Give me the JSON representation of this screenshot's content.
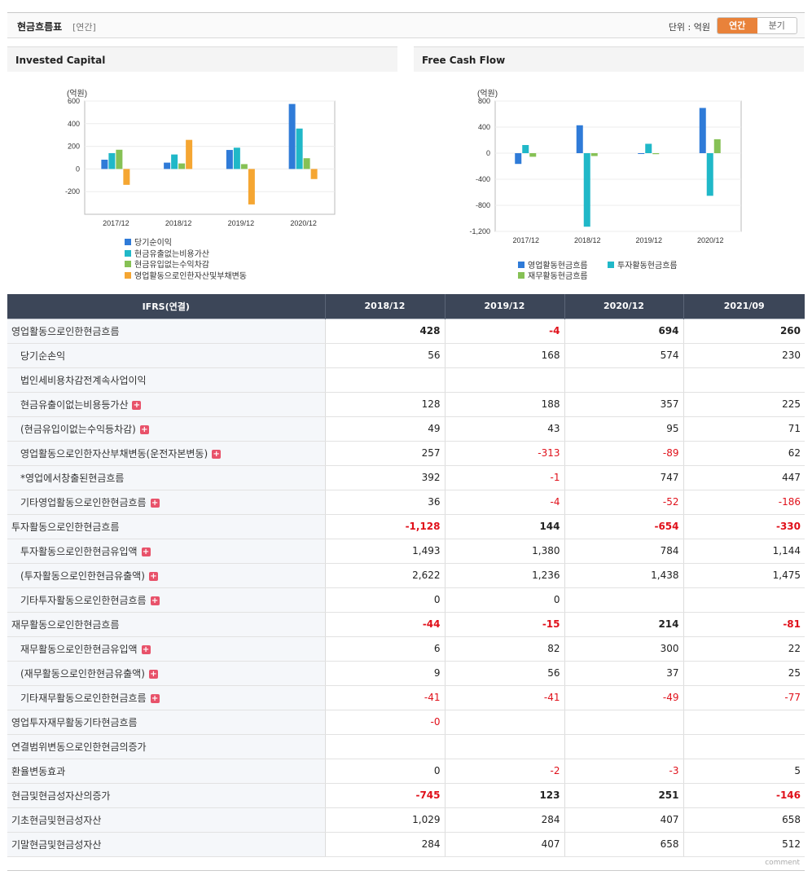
{
  "header": {
    "title": "현금흐름표",
    "period": "[연간]",
    "unit_label": "단위 : 억원",
    "tabs": [
      "연간",
      "분기"
    ]
  },
  "chart_data": [
    {
      "type": "bar",
      "title": "Invested Capital",
      "ylabel": "(억원)",
      "categories": [
        "2017/12",
        "2018/12",
        "2019/12",
        "2020/12"
      ],
      "ylim": [
        -400,
        600
      ],
      "yticks": [
        "600",
        "400",
        "200",
        "0",
        "-200"
      ],
      "series": [
        {
          "name": "당기순이익",
          "color": "#2f7bd8",
          "values": [
            82,
            56,
            168,
            574
          ]
        },
        {
          "name": "현금유출없는비용가산",
          "color": "#20b8c8",
          "values": [
            140,
            128,
            188,
            357
          ]
        },
        {
          "name": "현금유입없는수익차감",
          "color": "#86c155",
          "values": [
            170,
            49,
            43,
            95
          ]
        },
        {
          "name": "영업활동으로인한자산및부채변동",
          "color": "#f5a632",
          "values": [
            -140,
            257,
            -313,
            -89
          ]
        }
      ]
    },
    {
      "type": "bar",
      "title": "Free Cash Flow",
      "ylabel": "(억원)",
      "categories": [
        "2017/12",
        "2018/12",
        "2019/12",
        "2020/12"
      ],
      "ylim": [
        -1200,
        800
      ],
      "yticks": [
        "800",
        "400",
        "0",
        "-400",
        "-800",
        "-1,200"
      ],
      "series": [
        {
          "name": "영업활동현금흐름",
          "color": "#2f7bd8",
          "values": [
            -165,
            428,
            -4,
            694
          ]
        },
        {
          "name": "투자활동현금흐름",
          "color": "#20b8c8",
          "values": [
            125,
            -1128,
            144,
            -654
          ]
        },
        {
          "name": "재무활동현금흐름",
          "color": "#86c155",
          "values": [
            -55,
            -44,
            -15,
            214
          ]
        }
      ]
    }
  ],
  "table": {
    "headers": [
      "IFRS(연결)",
      "2018/12",
      "2019/12",
      "2020/12",
      "2021/09"
    ],
    "rows": [
      {
        "label": "영업활동으로인한현금흐름",
        "type": "main",
        "plus": false,
        "values": [
          "428",
          "-4",
          "694",
          "260"
        ]
      },
      {
        "label": "당기순손익",
        "type": "sub",
        "plus": false,
        "values": [
          "56",
          "168",
          "574",
          "230"
        ]
      },
      {
        "label": "법인세비용차감전계속사업이익",
        "type": "sub",
        "plus": false,
        "values": [
          "",
          "",
          "",
          ""
        ]
      },
      {
        "label": "현금유출이없는비용등가산",
        "type": "sub",
        "plus": true,
        "values": [
          "128",
          "188",
          "357",
          "225"
        ]
      },
      {
        "label": "(현금유입이없는수익등차감)",
        "type": "sub",
        "plus": true,
        "values": [
          "49",
          "43",
          "95",
          "71"
        ]
      },
      {
        "label": "영업활동으로인한자산부채변동(운전자본변동)",
        "type": "sub",
        "plus": true,
        "values": [
          "257",
          "-313",
          "-89",
          "62"
        ]
      },
      {
        "label": "*영업에서창출된현금흐름",
        "type": "sub",
        "plus": false,
        "values": [
          "392",
          "-1",
          "747",
          "447"
        ]
      },
      {
        "label": "기타영업활동으로인한현금흐름",
        "type": "sub",
        "plus": true,
        "values": [
          "36",
          "-4",
          "-52",
          "-186"
        ]
      },
      {
        "label": "투자활동으로인한현금흐름",
        "type": "main",
        "plus": false,
        "values": [
          "-1,128",
          "144",
          "-654",
          "-330"
        ]
      },
      {
        "label": "투자활동으로인한현금유입액",
        "type": "sub",
        "plus": true,
        "values": [
          "1,493",
          "1,380",
          "784",
          "1,144"
        ]
      },
      {
        "label": "(투자활동으로인한현금유출액)",
        "type": "sub",
        "plus": true,
        "values": [
          "2,622",
          "1,236",
          "1,438",
          "1,475"
        ]
      },
      {
        "label": "기타투자활동으로인한현금흐름",
        "type": "sub",
        "plus": true,
        "values": [
          "0",
          "0",
          "",
          ""
        ]
      },
      {
        "label": "재무활동으로인한현금흐름",
        "type": "main",
        "plus": false,
        "values": [
          "-44",
          "-15",
          "214",
          "-81"
        ]
      },
      {
        "label": "재무활동으로인한현금유입액",
        "type": "sub",
        "plus": true,
        "values": [
          "6",
          "82",
          "300",
          "22"
        ]
      },
      {
        "label": "(재무활동으로인한현금유출액)",
        "type": "sub",
        "plus": true,
        "values": [
          "9",
          "56",
          "37",
          "25"
        ]
      },
      {
        "label": "기타재무활동으로인한현금흐름",
        "type": "sub",
        "plus": true,
        "values": [
          "-41",
          "-41",
          "-49",
          "-77"
        ]
      },
      {
        "label": "영업투자재무활동기타현금흐름",
        "type": "other",
        "plus": false,
        "values": [
          "-0",
          "",
          "",
          ""
        ]
      },
      {
        "label": "연결범위변동으로인한현금의증가",
        "type": "other",
        "plus": false,
        "values": [
          "",
          "",
          "",
          ""
        ]
      },
      {
        "label": "환율변동효과",
        "type": "other",
        "plus": false,
        "values": [
          "0",
          "-2",
          "-3",
          "5"
        ]
      },
      {
        "label": "현금및현금성자산의증가",
        "type": "main",
        "plus": false,
        "values": [
          "-745",
          "123",
          "251",
          "-146"
        ]
      },
      {
        "label": "기초현금및현금성자산",
        "type": "other",
        "plus": false,
        "values": [
          "1,029",
          "284",
          "407",
          "658"
        ]
      },
      {
        "label": "기말현금및현금성자산",
        "type": "other",
        "plus": false,
        "values": [
          "284",
          "407",
          "658",
          "512"
        ]
      }
    ]
  },
  "footer": {
    "comment": "comment"
  }
}
